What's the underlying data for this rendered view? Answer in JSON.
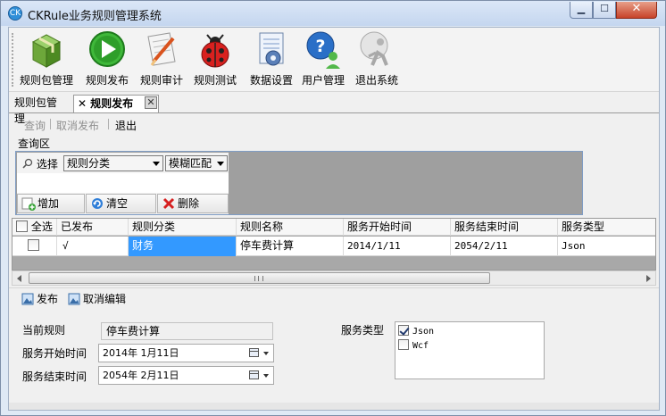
{
  "window": {
    "title": "CKRule业务规则管理系统",
    "minimize_glyph": "▁",
    "maximize_glyph": "☐",
    "close_glyph": "✕"
  },
  "toolbar": {
    "items": [
      {
        "label": "规则包管理",
        "icon": "package-box-icon"
      },
      {
        "label": "规则发布",
        "icon": "play-arrow-icon"
      },
      {
        "label": "规则审计",
        "icon": "edit-document-icon"
      },
      {
        "label": "规则测试",
        "icon": "ladybug-icon"
      },
      {
        "label": "数据设置",
        "icon": "document-settings-icon"
      },
      {
        "label": "用户管理",
        "icon": "user-help-icon"
      },
      {
        "label": "退出系统",
        "icon": "exit-person-icon"
      }
    ]
  },
  "tabs": {
    "items": [
      {
        "label": "规则包管理",
        "active": false
      },
      {
        "label": "规则发布",
        "active": true
      }
    ],
    "active_close_glyph": "✕",
    "close_glyph": "✕"
  },
  "subtoolbar": {
    "query": "查询",
    "cancel_publish": "取消发布",
    "exit": "退出"
  },
  "query_area": {
    "title": "查询区",
    "select_label": "选择",
    "category_combo": "规则分类",
    "match_combo": "模糊匹配",
    "add_button": "增加",
    "clear_button": "清空",
    "delete_button": "删除"
  },
  "grid": {
    "columns": [
      "全选",
      "已发布",
      "规则分类",
      "规则名称",
      "服务开始时间",
      "服务结束时间",
      "服务类型"
    ],
    "rows": [
      {
        "checked": false,
        "published": "√",
        "category": "财务",
        "name": "停车费计算",
        "start": "2014/1/11",
        "end": "2054/2/11",
        "type": "Json"
      }
    ],
    "scroll_grip": "|||"
  },
  "edit_bar": {
    "publish": "发布",
    "cancel_edit": "取消编辑"
  },
  "form": {
    "current_rule_label": "当前规则",
    "current_rule_value": "停车费计算",
    "start_label": "服务开始时间",
    "start_value": "2014年  1月11日",
    "end_label": "服务结束时间",
    "end_value": "2054年  2月11日",
    "service_type_label": "服务类型",
    "service_types": [
      {
        "label": "Json",
        "checked": true
      },
      {
        "label": "Wcf",
        "checked": false
      }
    ]
  },
  "colors": {
    "selection": "#3399ff",
    "query_panel_border": "#7f9cc4",
    "grid_empty": "#a8a8a8"
  }
}
